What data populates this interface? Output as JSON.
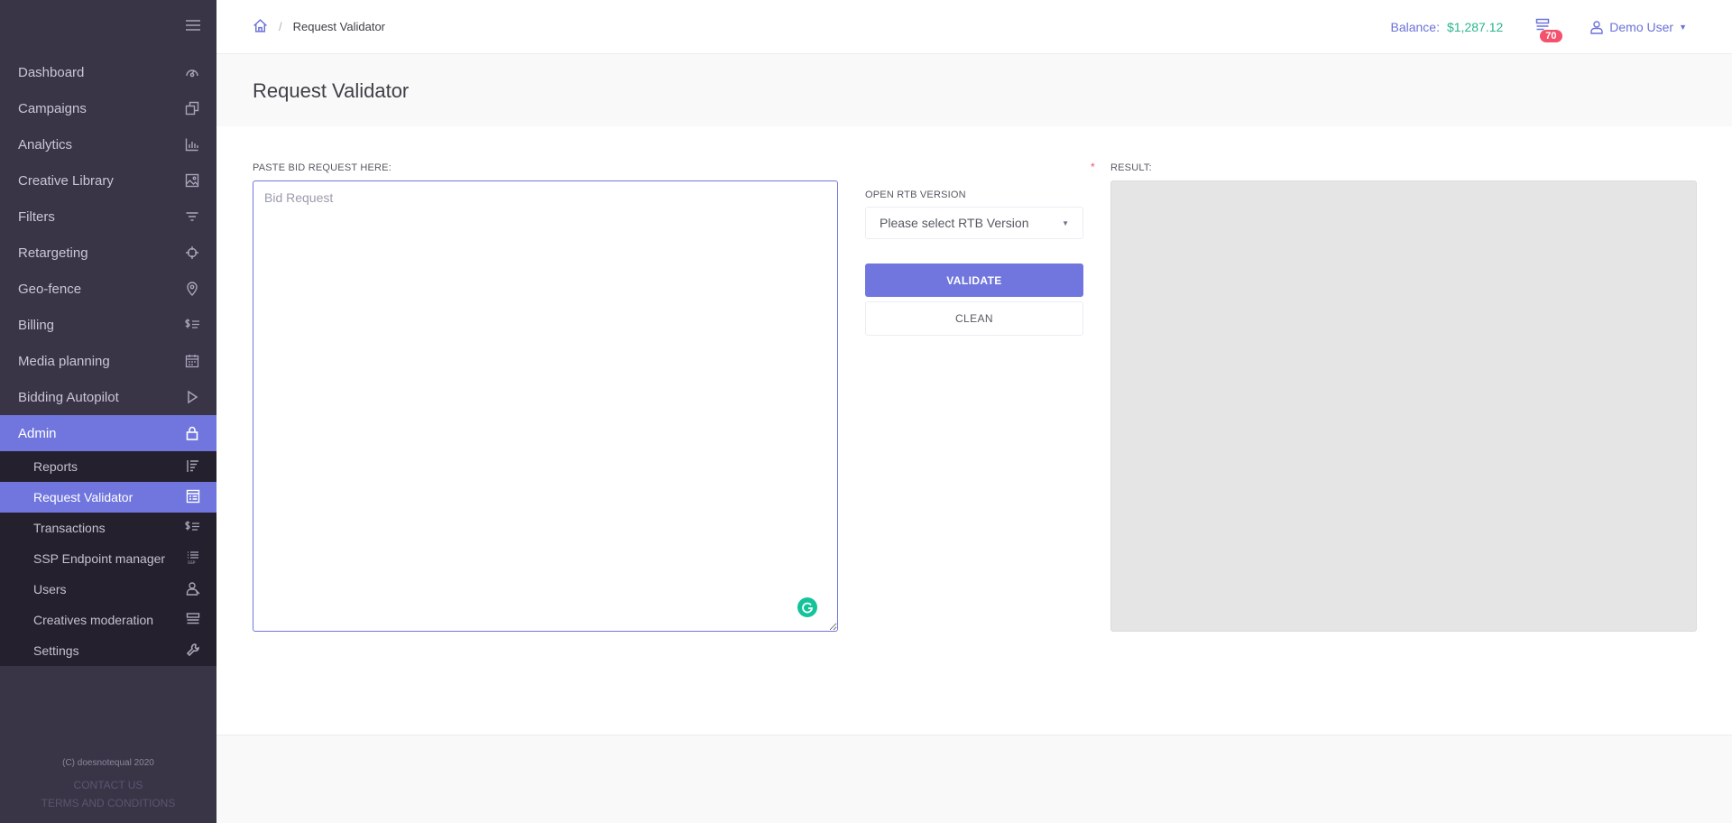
{
  "sidebar": {
    "menu": [
      {
        "label": "Dashboard",
        "icon": "dashboard-icon"
      },
      {
        "label": "Campaigns",
        "icon": "campaigns-icon"
      },
      {
        "label": "Analytics",
        "icon": "analytics-icon"
      },
      {
        "label": "Creative Library",
        "icon": "image-icon"
      },
      {
        "label": "Filters",
        "icon": "filter-icon"
      },
      {
        "label": "Retargeting",
        "icon": "crosshair-icon"
      },
      {
        "label": "Geo-fence",
        "icon": "location-pin-icon"
      },
      {
        "label": "Billing",
        "icon": "billing-icon"
      },
      {
        "label": "Media planning",
        "icon": "calendar-icon"
      },
      {
        "label": "Bidding Autopilot",
        "icon": "play-icon"
      },
      {
        "label": "Admin",
        "icon": "lock-icon"
      }
    ],
    "submenu": [
      {
        "label": "Reports",
        "icon": "reports-icon"
      },
      {
        "label": "Request Validator",
        "icon": "validator-icon"
      },
      {
        "label": "Transactions",
        "icon": "transactions-icon"
      },
      {
        "label": "SSP Endpoint manager",
        "icon": "ssp-list-icon"
      },
      {
        "label": "Users",
        "icon": "users-icon"
      },
      {
        "label": "Creatives moderation",
        "icon": "moderation-icon"
      },
      {
        "label": "Settings",
        "icon": "wrench-icon"
      }
    ],
    "footer": {
      "copyright": "(C) doesnotequal 2020",
      "contact": "CONTACT US",
      "terms": "TERMS AND CONDITIONS"
    }
  },
  "topbar": {
    "breadcrumb": "Request Validator",
    "balance_label": "Balance:",
    "balance_value": "$1,287.12",
    "notification_count": "70",
    "user_name": "Demo User"
  },
  "page": {
    "title": "Request Validator",
    "bid_label": "PASTE BID REQUEST HERE:",
    "bid_placeholder": "Bid Request",
    "required_mark": "*",
    "rtb_label": "OPEN RTB VERSION",
    "rtb_selected": "Please select RTB Version",
    "validate_label": "VALIDATE",
    "clean_label": "CLEAN",
    "result_label": "RESULT:"
  },
  "colors": {
    "accent": "#7076de",
    "sidebar_bg": "#3a3447",
    "balance": "#2bb58f",
    "badge": "#f4516c"
  }
}
